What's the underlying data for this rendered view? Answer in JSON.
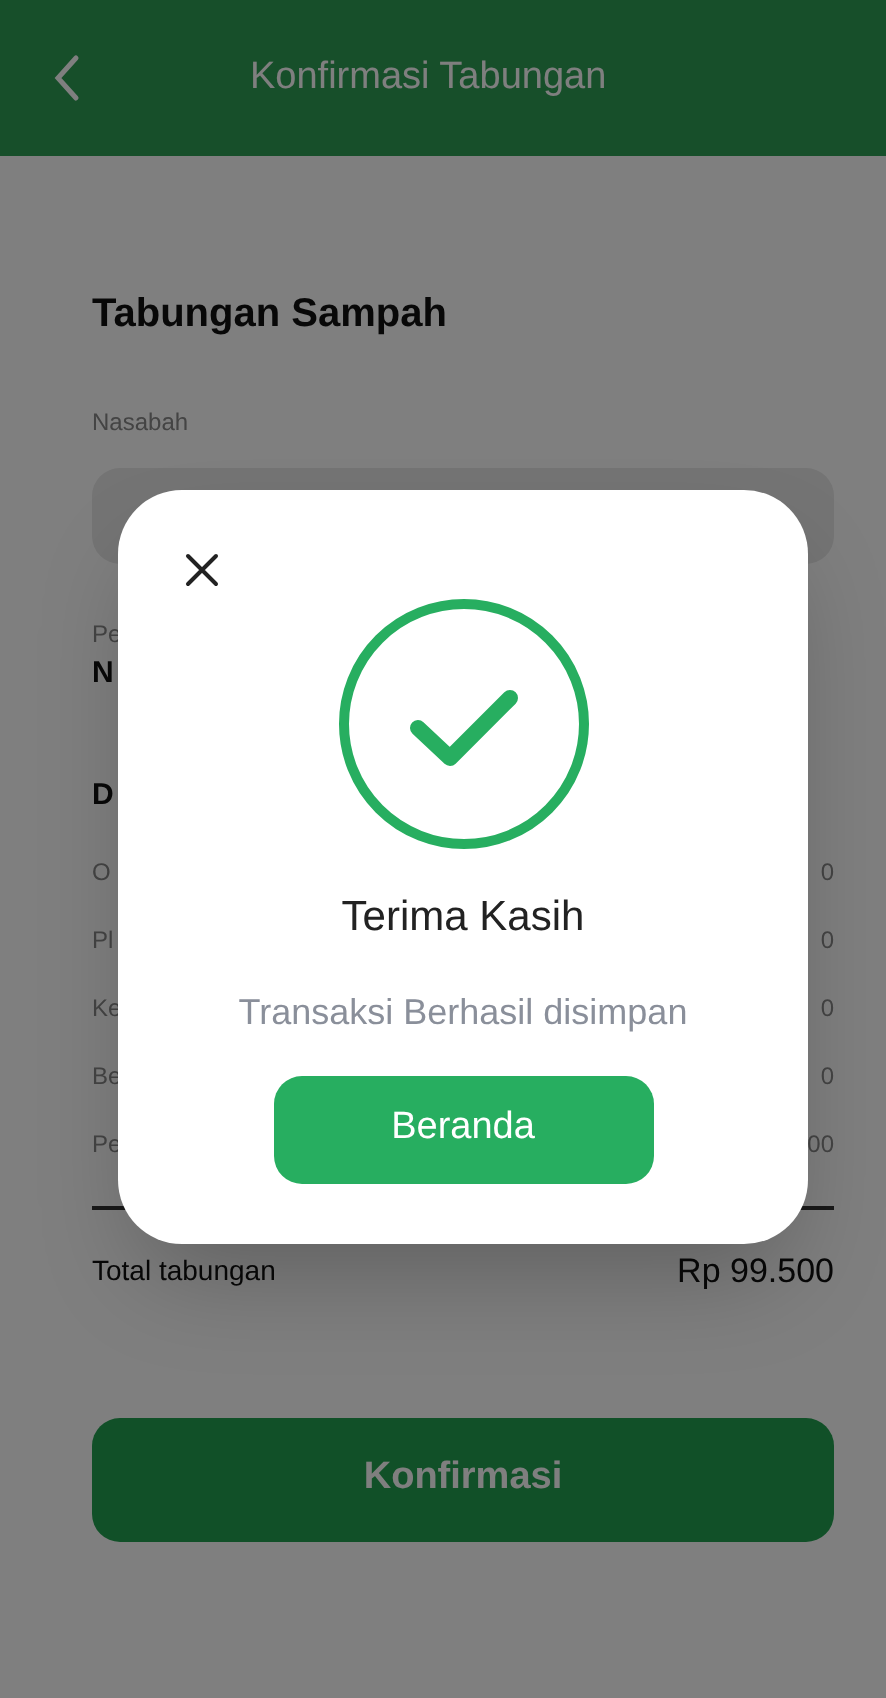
{
  "header": {
    "title": "Konfirmasi Tabungan"
  },
  "page_title": "Tabungan Sampah",
  "nasabah": {
    "label": "Nasabah"
  },
  "field_2": {
    "label": "Pe",
    "value": "N"
  },
  "details": {
    "heading": "D",
    "rows": [
      {
        "label": "O",
        "value": "0"
      },
      {
        "label": "Pl",
        "value": "0"
      },
      {
        "label": "Ke",
        "value": "0"
      },
      {
        "label": "Be",
        "value": "0"
      },
      {
        "label": "Pe",
        "value": "00"
      }
    ]
  },
  "total": {
    "label": "Total tabungan",
    "value": "Rp 99.500"
  },
  "confirm_button": "Konfirmasi",
  "dialog": {
    "title": "Terima Kasih",
    "message": "Transaksi Berhasil disimpan",
    "button": "Beranda"
  }
}
